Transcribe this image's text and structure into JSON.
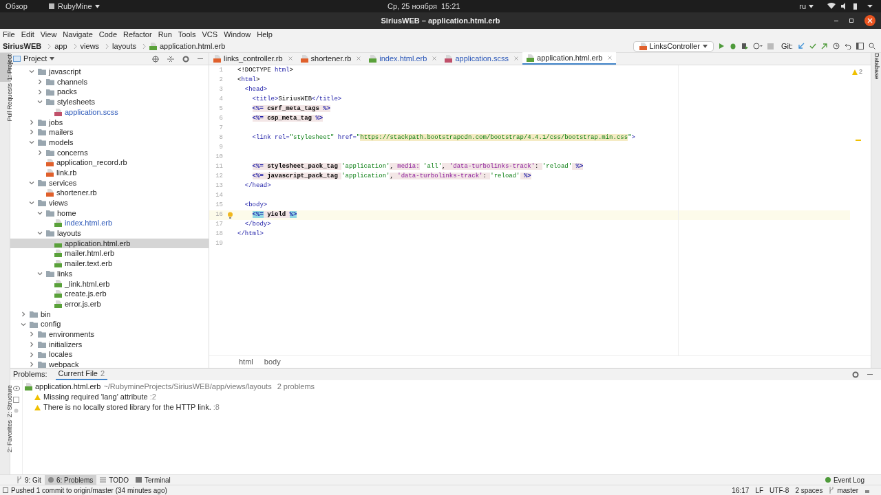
{
  "os_bar": {
    "overview": "Обзор",
    "app": "RubyMine",
    "clock": "Ср, 25 ноября  15:21",
    "lang": "ru"
  },
  "window": {
    "title": "SiriusWEB – application.html.erb"
  },
  "menu": [
    "File",
    "Edit",
    "View",
    "Navigate",
    "Code",
    "Refactor",
    "Run",
    "Tools",
    "VCS",
    "Window",
    "Help"
  ],
  "nav": {
    "crumbs": [
      "SiriusWEB",
      "app",
      "views",
      "layouts",
      "application.html.erb"
    ],
    "run_config": "LinksController",
    "git_label": "Git:"
  },
  "left_stripe": [
    {
      "label": "1: Project",
      "selected": true
    },
    {
      "label": "Pull Requests",
      "selected": false
    }
  ],
  "left_stripe_bottom": [
    {
      "label": "Z: Structure",
      "selected": false
    },
    {
      "label": "2: Favorites",
      "selected": false
    }
  ],
  "right_stripe": [
    "Database"
  ],
  "project": {
    "title": "Project",
    "tree": [
      {
        "children": [
          {
            "name": "javascript",
            "kind": "folder",
            "expanded": true,
            "children": [
              {
                "name": "channels",
                "kind": "folder",
                "expanded": false
              },
              {
                "name": "packs",
                "kind": "folder",
                "expanded": false
              },
              {
                "name": "stylesheets",
                "kind": "folder",
                "expanded": true,
                "children": [
                  {
                    "name": "application.scss",
                    "kind": "scss",
                    "modified": true,
                    "selected": false
                  }
                ]
              }
            ]
          },
          {
            "name": "jobs",
            "kind": "folder",
            "expanded": false
          },
          {
            "name": "mailers",
            "kind": "folder",
            "expanded": false
          },
          {
            "name": "models",
            "kind": "folder",
            "expanded": true,
            "children": [
              {
                "name": "concerns",
                "kind": "folder",
                "expanded": false
              },
              {
                "name": "application_record.rb",
                "kind": "ruby",
                "modified": false,
                "selected": false
              },
              {
                "name": "link.rb",
                "kind": "ruby",
                "modified": false,
                "selected": false
              }
            ]
          },
          {
            "name": "services",
            "kind": "folder",
            "expanded": true,
            "children": [
              {
                "name": "shortener.rb",
                "kind": "ruby",
                "modified": false,
                "selected": false
              }
            ]
          },
          {
            "name": "views",
            "kind": "folder",
            "expanded": true,
            "children": [
              {
                "name": "home",
                "kind": "folder",
                "expanded": true,
                "children": [
                  {
                    "name": "index.html.erb",
                    "kind": "erb",
                    "modified": true,
                    "selected": false
                  }
                ]
              },
              {
                "name": "layouts",
                "kind": "folder",
                "expanded": true,
                "children": [
                  {
                    "name": "application.html.erb",
                    "kind": "erb",
                    "modified": false,
                    "selected": true
                  },
                  {
                    "name": "mailer.html.erb",
                    "kind": "erb",
                    "modified": false,
                    "selected": false
                  },
                  {
                    "name": "mailer.text.erb",
                    "kind": "erb",
                    "modified": false,
                    "selected": false
                  }
                ]
              },
              {
                "name": "links",
                "kind": "folder",
                "expanded": true,
                "children": [
                  {
                    "name": "_link.html.erb",
                    "kind": "erb",
                    "modified": false,
                    "selected": false
                  },
                  {
                    "name": "create.js.erb",
                    "kind": "erb",
                    "modified": false,
                    "selected": false
                  },
                  {
                    "name": "error.js.erb",
                    "kind": "erb",
                    "modified": false,
                    "selected": false
                  }
                ]
              }
            ]
          }
        ]
      },
      {
        "name": "bin",
        "kind": "folder",
        "expanded": false
      },
      {
        "name": "config",
        "kind": "folder",
        "expanded": true,
        "children": [
          {
            "name": "environments",
            "kind": "folder",
            "expanded": false
          },
          {
            "name": "initializers",
            "kind": "folder",
            "expanded": false
          },
          {
            "name": "locales",
            "kind": "folder",
            "expanded": false
          },
          {
            "name": "webpack",
            "kind": "folder",
            "expanded": false
          }
        ]
      }
    ]
  },
  "tabs": [
    {
      "label": "links_controller.rb",
      "kind": "ruby",
      "modified": false,
      "selected": false
    },
    {
      "label": "shortener.rb",
      "kind": "ruby",
      "modified": false,
      "selected": false
    },
    {
      "label": "index.html.erb",
      "kind": "erb",
      "modified": true,
      "selected": false
    },
    {
      "label": "application.scss",
      "kind": "scss",
      "modified": true,
      "selected": false
    },
    {
      "label": "application.html.erb",
      "kind": "erb",
      "modified": false,
      "selected": true
    }
  ],
  "warnings_count": "2",
  "code": [
    {
      "n": "1",
      "current": false,
      "bulb": false,
      "tokens": [
        {
          "text": "<!DOCTYPE ",
          "kind": "plain"
        },
        {
          "text": "html",
          "kind": "tag"
        },
        {
          "text": ">",
          "kind": "plain"
        }
      ]
    },
    {
      "n": "2",
      "current": false,
      "bulb": false,
      "tokens": [
        {
          "text": "<",
          "kind": "plain"
        },
        {
          "text": "html",
          "kind": "tag"
        },
        {
          "text": ">",
          "kind": "plain"
        }
      ]
    },
    {
      "n": "3",
      "current": false,
      "bulb": false,
      "tokens": [
        {
          "text": "  <head>",
          "kind": "tag"
        }
      ]
    },
    {
      "n": "4",
      "current": false,
      "bulb": false,
      "tokens": [
        {
          "text": "    <title>",
          "kind": "tag"
        },
        {
          "text": "SiriusWEB",
          "kind": "plain"
        },
        {
          "text": "</title>",
          "kind": "tag"
        }
      ]
    },
    {
      "n": "5",
      "current": false,
      "bulb": false,
      "indented": true,
      "tokens": [
        {
          "text": "<%=",
          "kind": "erb"
        },
        {
          "text": " csrf_meta_tags ",
          "kind": "bold"
        },
        {
          "text": "%>",
          "kind": "erb"
        }
      ]
    },
    {
      "n": "6",
      "current": false,
      "bulb": false,
      "indented": true,
      "tokens": [
        {
          "text": "<%=",
          "kind": "erb"
        },
        {
          "text": " csp_meta_tag ",
          "kind": "bold"
        },
        {
          "text": "%>",
          "kind": "erb"
        }
      ]
    },
    {
      "n": "7",
      "current": false,
      "bulb": false
    },
    {
      "n": "8",
      "current": false,
      "bulb": false,
      "tokens": [
        {
          "text": "    <link rel=",
          "kind": "tag"
        },
        {
          "text": "\"stylesheet\"",
          "kind": "string"
        },
        {
          "text": " href=",
          "kind": "tag"
        },
        {
          "text": "\"",
          "kind": "string"
        },
        {
          "text": "https://stackpath.bootstrapcdn.com/bootstrap/4.4.1/css/bootstrap.min.css",
          "kind": "url"
        },
        {
          "text": "\"",
          "kind": "string"
        },
        {
          "text": ">",
          "kind": "tag"
        }
      ]
    },
    {
      "n": "9",
      "current": false,
      "bulb": false
    },
    {
      "n": "10",
      "current": false,
      "bulb": false
    },
    {
      "n": "11",
      "current": false,
      "bulb": false,
      "indented": true,
      "tokens": [
        {
          "text": "<%=",
          "kind": "erb"
        },
        {
          "text": " stylesheet_pack_tag ",
          "kind": "bold"
        },
        {
          "text": "'application'",
          "kind": "string"
        },
        {
          "text": ", ",
          "kind": "punct"
        },
        {
          "text": "media:",
          "kind": "symbol"
        },
        {
          "text": " 'all'",
          "kind": "string"
        },
        {
          "text": ", ",
          "kind": "punct"
        },
        {
          "text": "'data-turbolinks-track'",
          "kind": "symbol"
        },
        {
          "text": ": ",
          "kind": "punct"
        },
        {
          "text": "'reload'",
          "kind": "string"
        },
        {
          "text": " %>",
          "kind": "erb"
        }
      ]
    },
    {
      "n": "12",
      "current": false,
      "bulb": false,
      "indented": true,
      "tokens": [
        {
          "text": "<%=",
          "kind": "erb"
        },
        {
          "text": " javascript_pack_tag ",
          "kind": "bold"
        },
        {
          "text": "'application'",
          "kind": "string"
        },
        {
          "text": ", ",
          "kind": "punct"
        },
        {
          "text": "'data-turbolinks-track'",
          "kind": "symbol"
        },
        {
          "text": ": ",
          "kind": "punct"
        },
        {
          "text": "'reload'",
          "kind": "string"
        },
        {
          "text": " %>",
          "kind": "erb"
        }
      ]
    },
    {
      "n": "13",
      "current": false,
      "bulb": false,
      "tokens": [
        {
          "text": "  </head>",
          "kind": "tag"
        }
      ]
    },
    {
      "n": "14",
      "current": false,
      "bulb": false
    },
    {
      "n": "15",
      "current": false,
      "bulb": false,
      "tokens": [
        {
          "text": "  <body>",
          "kind": "tag"
        }
      ]
    },
    {
      "n": "16",
      "current": true,
      "bulb": true,
      "indented": true,
      "tokens": [
        {
          "text": "<%=",
          "kind": "match"
        },
        {
          "text": " yield ",
          "kind": "bold"
        },
        {
          "text": "%>",
          "kind": "match"
        }
      ]
    },
    {
      "n": "17",
      "current": false,
      "bulb": false,
      "tokens": [
        {
          "text": "  </body>",
          "kind": "tag"
        }
      ]
    },
    {
      "n": "18",
      "current": false,
      "bulb": false,
      "tokens": [
        {
          "text": "</html>",
          "kind": "tag"
        }
      ]
    },
    {
      "n": "19",
      "current": false,
      "bulb": false
    }
  ],
  "editor_breadcrumb": [
    "html",
    "body"
  ],
  "problems": {
    "label": "Problems:",
    "tabs": [
      {
        "label": "Current File",
        "count": "2",
        "selected": true
      }
    ],
    "file": {
      "name": "application.html.erb",
      "path": "~/RubymineProjects/SiriusWEB/app/views/layouts",
      "count": "2 problems"
    },
    "items": [
      {
        "text": "Missing required 'lang' attribute",
        "line": ":2"
      },
      {
        "text": "There is no locally stored library for the HTTP link.",
        "line": ":8"
      }
    ]
  },
  "tool_tabs": [
    {
      "label": "9: Git",
      "kind": "git",
      "selected": false
    },
    {
      "label": "6: Problems",
      "kind": "problems",
      "selected": true
    },
    {
      "label": "TODO",
      "kind": "todo",
      "selected": false
    },
    {
      "label": "Terminal",
      "kind": "terminal",
      "selected": false
    }
  ],
  "event_log": "Event Log",
  "status_bar": {
    "message": "Pushed 1 commit to origin/master (34 minutes ago)",
    "position": "16:17",
    "line_sep": "LF",
    "encoding": "UTF-8",
    "indent": "2 spaces",
    "branch": "master"
  }
}
